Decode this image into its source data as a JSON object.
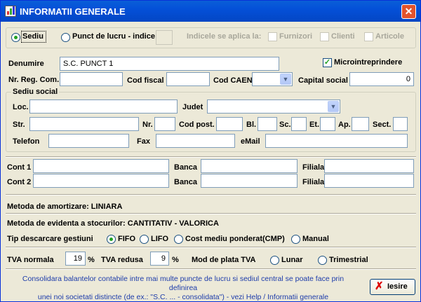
{
  "window": {
    "title": "INFORMATII GENERALE",
    "close_glyph": "✕"
  },
  "entity": {
    "sediu_label": "Sediu",
    "punct_label": "Punct de lucru - indice",
    "indice_note": "Indicele se aplica la:",
    "furnizori_label": "Furnizori",
    "clienti_label": "Clienti",
    "articole_label": "Articole",
    "selected": "Sediu"
  },
  "company": {
    "denumire_label": "Denumire",
    "denumire_value": "S.C. PUNCT 1",
    "micro_label": "Microintreprindere",
    "micro_checked": true,
    "nr_reg_label": "Nr. Reg. Com.",
    "cod_fiscal_label": "Cod fiscal",
    "cod_caen_label": "Cod CAEN",
    "capital_label": "Capital social",
    "capital_value": "0"
  },
  "sediu_social": {
    "group_label": "Sediu social",
    "loc_label": "Loc.",
    "judet_label": "Judet",
    "str_label": "Str.",
    "nr_label": "Nr.",
    "cod_post_label": "Cod post.",
    "bl_label": "Bl.",
    "sc_label": "Sc.",
    "et_label": "Et.",
    "ap_label": "Ap.",
    "sect_label": "Sect.",
    "telefon_label": "Telefon",
    "fax_label": "Fax",
    "email_label": "eMail"
  },
  "bank": {
    "cont1_label": "Cont 1",
    "cont2_label": "Cont 2",
    "banca_label": "Banca",
    "filiala_label": "Filiala"
  },
  "metoda_amortizare": "Metoda de amortizare: LINIARA",
  "metoda_stocuri": "Metoda de evidenta a stocurilor: CANTITATIV - VALORICA",
  "descarcare": {
    "label": "Tip descarcare gestiuni",
    "options": [
      "FIFO",
      "LIFO",
      "Cost mediu ponderat(CMP)",
      "Manual"
    ],
    "selected": "FIFO"
  },
  "tva": {
    "normala_label": "TVA normala",
    "normala_value": "19",
    "redusa_label": "TVA redusa",
    "redusa_value": "9",
    "percent": "%",
    "mod_label": "Mod de plata TVA",
    "lunar_label": "Lunar",
    "trimestrial_label": "Trimestrial",
    "selected": null
  },
  "footer": {
    "info_line1": "Consolidara balantelor contabile intre mai multe puncte de lucru si sediul central se poate face prin definirea",
    "info_line2": "unei noi societati distincte (de ex.: \"S.C. ... - consolidata\") - vezi Help / Informatii generale",
    "exit_label": "Iesire"
  },
  "colors": {
    "title_bar": "#0450d8",
    "window_bg": "#ece9d8",
    "info_text": "#1d3caa",
    "radio_dot": "#21a121"
  }
}
